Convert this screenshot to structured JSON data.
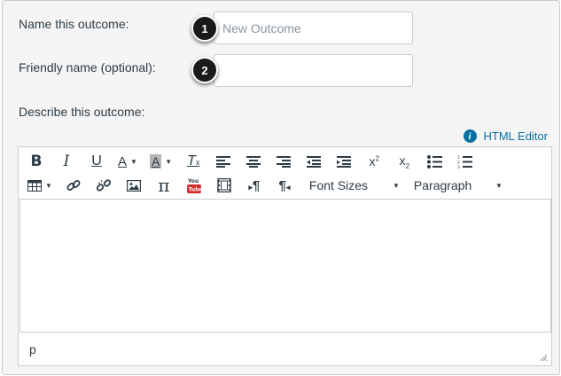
{
  "form": {
    "name_label": "Name this outcome:",
    "name_placeholder": "New Outcome",
    "name_value": "",
    "friendly_label": "Friendly name (optional):",
    "friendly_placeholder": "",
    "friendly_value": "",
    "describe_label": "Describe this outcome:"
  },
  "callouts": {
    "badge_1": "1",
    "badge_2": "2"
  },
  "editor": {
    "html_editor_link": "HTML Editor",
    "info_icon_glyph": "i",
    "font_sizes_label": "Font Sizes",
    "format_label": "Paragraph",
    "status_path": "p",
    "toolbar_row1_icons": [
      "bold-icon",
      "italic-icon",
      "underline-icon",
      "text-color-icon",
      "background-color-icon",
      "clear-formatting-icon",
      "align-left-icon",
      "align-center-icon",
      "align-right-icon",
      "outdent-icon",
      "indent-icon",
      "superscript-icon",
      "subscript-icon",
      "bullet-list-icon",
      "numbered-list-icon"
    ],
    "toolbar_row2_icons": [
      "table-icon",
      "link-icon",
      "unlink-icon",
      "image-icon",
      "math-icon",
      "youtube-icon",
      "media-icon",
      "ltr-icon",
      "rtl-icon"
    ]
  },
  "colors": {
    "accent": "#0770a3",
    "badge_bg": "#1a1a1a",
    "panel_bg": "#f5f5f5",
    "border": "#c7cdd1",
    "text": "#2d3b45"
  }
}
